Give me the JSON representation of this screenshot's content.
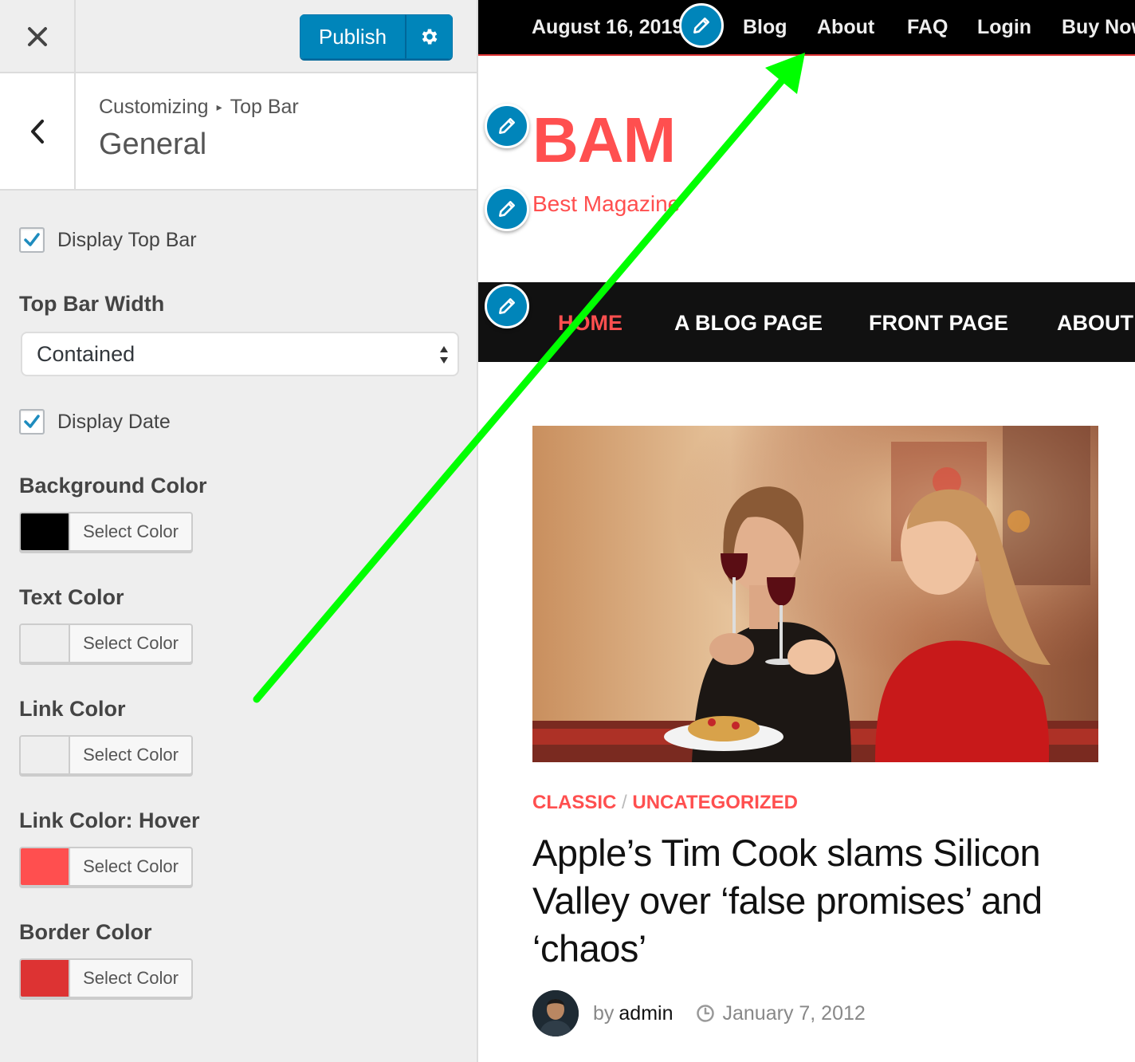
{
  "customizer": {
    "close_icon": "close-icon",
    "publish_label": "Publish",
    "settings_icon": "gear-icon",
    "back_icon": "chevron-left-icon",
    "breadcrumb": {
      "root": "Customizing",
      "parent": "Top Bar"
    },
    "section_title": "General",
    "display_top_bar": {
      "label": "Display Top Bar",
      "checked": true
    },
    "top_bar_width": {
      "title": "Top Bar Width",
      "selected": "Contained"
    },
    "display_date": {
      "label": "Display Date",
      "checked": true
    },
    "color_controls": [
      {
        "title": "Background Color",
        "button": "Select Color",
        "color": "#000000"
      },
      {
        "title": "Text Color",
        "button": "Select Color",
        "color": "#eeeeee"
      },
      {
        "title": "Link Color",
        "button": "Select Color",
        "color": "#eeeeee"
      },
      {
        "title": "Link Color: Hover",
        "button": "Select Color",
        "color": "#ff4f4f"
      },
      {
        "title": "Border Color",
        "button": "Select Color",
        "color": "#dd3333"
      }
    ]
  },
  "preview": {
    "top_bar": {
      "date": "August 16, 2019",
      "links": [
        "Blog",
        "About",
        "FAQ",
        "Login",
        "Buy Now"
      ]
    },
    "site": {
      "title": "BAM",
      "tagline": "Best Magazine"
    },
    "main_nav": [
      "HOME",
      "A BLOG PAGE",
      "FRONT PAGE",
      "ABOUT"
    ],
    "post": {
      "categories": [
        "CLASSIC",
        "UNCATEGORIZED"
      ],
      "category_separator": "/",
      "title": "Apple’s Tim Cook slams Silicon Valley over ‘false promises’ and ‘chaos’",
      "by": "by",
      "author": "admin",
      "date": "January 7, 2012"
    }
  },
  "colors": {
    "accent": "#ff4f4f",
    "wp_blue": "#0085ba",
    "annotation_arrow": "#00ff00"
  }
}
